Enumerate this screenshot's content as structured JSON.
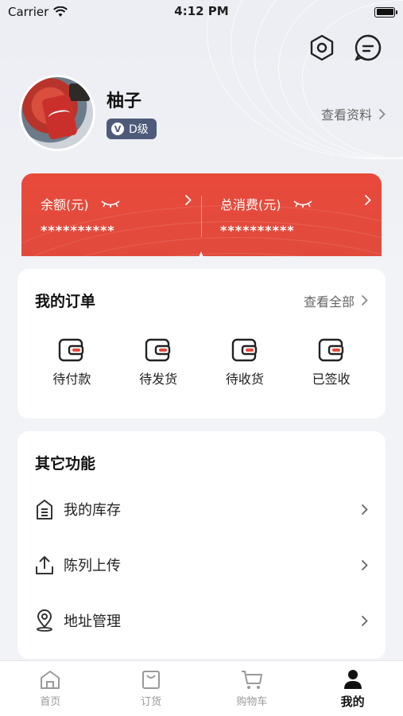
{
  "status_bar": {
    "carrier": "Carrier",
    "time": "4:12 PM"
  },
  "top_icons": [
    "settings-hex-icon",
    "message-bubble-icon"
  ],
  "profile": {
    "name": "柚子",
    "level": "D级",
    "level_badge_letter": "V",
    "view_profile": "查看资料"
  },
  "wallet": {
    "balance_label": "余额(元)",
    "balance_value": "**********",
    "spend_label": "总消费(元)",
    "spend_value": "**********",
    "accent": "#E44A3B"
  },
  "orders": {
    "title": "我的订单",
    "view_all": "查看全部",
    "items": [
      {
        "label": "待付款",
        "icon": "wallet-icon"
      },
      {
        "label": "待发货",
        "icon": "wallet-icon"
      },
      {
        "label": "待收货",
        "icon": "wallet-icon"
      },
      {
        "label": "已签收",
        "icon": "wallet-icon"
      }
    ]
  },
  "functions": {
    "title": "其它功能",
    "items": [
      {
        "label": "我的库存",
        "icon": "warehouse-icon"
      },
      {
        "label": "陈列上传",
        "icon": "upload-icon"
      },
      {
        "label": "地址管理",
        "icon": "location-pin-icon"
      }
    ]
  },
  "tabs": [
    {
      "label": "首页",
      "icon": "home-icon",
      "active": false
    },
    {
      "label": "订货",
      "icon": "bag-icon",
      "active": false
    },
    {
      "label": "购物车",
      "icon": "cart-icon",
      "active": false
    },
    {
      "label": "我的",
      "icon": "person-icon",
      "active": true
    }
  ]
}
